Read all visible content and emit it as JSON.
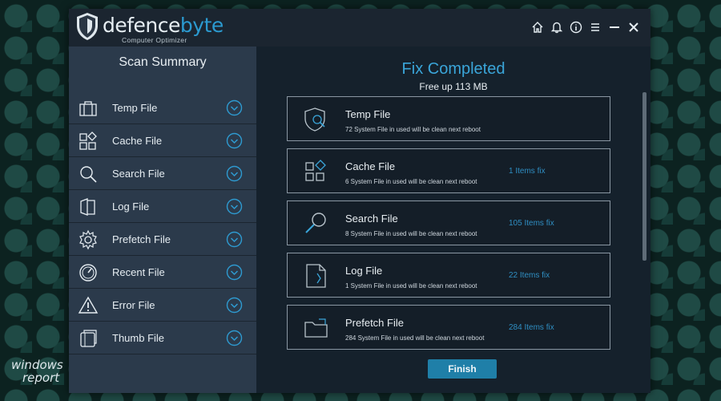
{
  "app": {
    "brand_part1": "defence",
    "brand_part2": "byte",
    "tagline": "Computer Optimizer",
    "controls": [
      "home-icon",
      "bell-icon",
      "info-icon",
      "menu-icon",
      "minimize-icon",
      "close-icon"
    ]
  },
  "sidebar": {
    "title": "Scan Summary",
    "items": [
      {
        "label": "Temp File",
        "icon": "briefcase-icon"
      },
      {
        "label": "Cache File",
        "icon": "grid-icon"
      },
      {
        "label": "Search File",
        "icon": "magnifier-icon"
      },
      {
        "label": "Log File",
        "icon": "log-icon"
      },
      {
        "label": "Prefetch File",
        "icon": "gear-icon"
      },
      {
        "label": "Recent File",
        "icon": "clock-icon"
      },
      {
        "label": "Error File",
        "icon": "warning-icon"
      },
      {
        "label": "Thumb File",
        "icon": "thumb-icon"
      }
    ]
  },
  "main": {
    "heading": "Fix Completed",
    "subheading": "Free up 113 MB",
    "cards": [
      {
        "title": "Temp File",
        "desc": "72 System File in used will be clean next reboot",
        "count": "",
        "icon": "shield-search-icon"
      },
      {
        "title": "Cache File",
        "desc": "6 System File in used will be clean next reboot",
        "count": "1 Items fix",
        "icon": "grid-icon"
      },
      {
        "title": "Search File",
        "desc": "8 System File in used will be clean next reboot",
        "count": "105 Items fix",
        "icon": "magnifier-icon"
      },
      {
        "title": "Log File",
        "desc": "1 System File in used will be clean next reboot",
        "count": "22 Items fix",
        "icon": "document-icon"
      },
      {
        "title": "Prefetch File",
        "desc": "284 System File in used will be clean next reboot",
        "count": "284 Items fix",
        "icon": "folder-icon"
      }
    ],
    "finish_label": "Finish"
  },
  "watermark": {
    "line1": "windows",
    "line2": "report"
  },
  "colors": {
    "accent": "#3aa5d9",
    "button": "#1f7fa8",
    "sidebar": "#2b3a4b",
    "panel": "#15212c"
  }
}
